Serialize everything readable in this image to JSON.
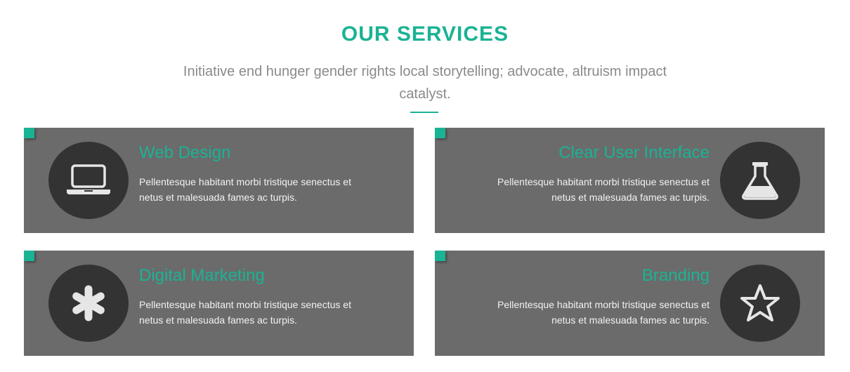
{
  "section": {
    "title": "OUR SERVICES",
    "subtitle": "Initiative end hunger gender rights local storytelling; advocate, altruism impact catalyst."
  },
  "colors": {
    "accent": "#1ab394",
    "card_background": "#6b6b6b",
    "icon_circle": "#333333",
    "subtitle_text": "#8a8a8a"
  },
  "services": [
    {
      "title": "Web Design",
      "description": "Pellentesque habitant morbi tristique senectus et netus et malesuada fames ac turpis.",
      "icon": "laptop-icon"
    },
    {
      "title": "Clear User Interface",
      "description": "Pellentesque habitant morbi tristique senectus et netus et malesuada fames ac turpis.",
      "icon": "flask-icon"
    },
    {
      "title": "Digital Marketing",
      "description": "Pellentesque habitant morbi tristique senectus et netus et malesuada fames ac turpis.",
      "icon": "asterisk-icon"
    },
    {
      "title": "Branding",
      "description": "Pellentesque habitant morbi tristique senectus et netus et malesuada fames ac turpis.",
      "icon": "star-icon"
    }
  ]
}
